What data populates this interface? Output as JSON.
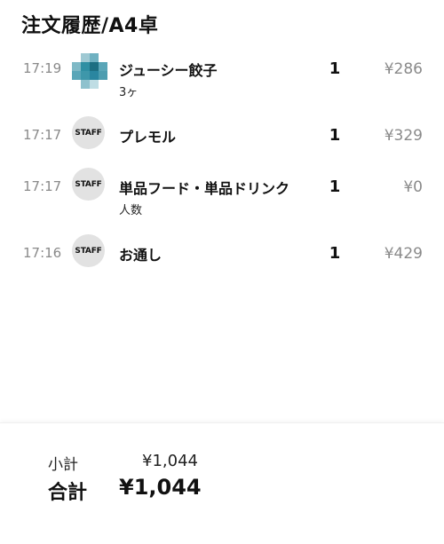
{
  "header": {
    "title": "注文履歴/A4卓"
  },
  "orders": [
    {
      "time": "17:19",
      "avatar_type": "image",
      "icon": "food-photo-thumbnail",
      "name": "ジューシー餃子",
      "sub": "3ヶ",
      "qty": "1",
      "price": "¥286"
    },
    {
      "time": "17:17",
      "avatar_type": "staff",
      "avatar_label": "STAFF",
      "name": "プレモル",
      "sub": "",
      "qty": "1",
      "price": "¥329"
    },
    {
      "time": "17:17",
      "avatar_type": "staff",
      "avatar_label": "STAFF",
      "name": "単品フード・単品ドリンク",
      "sub": "人数",
      "qty": "1",
      "price": "¥0"
    },
    {
      "time": "17:16",
      "avatar_type": "staff",
      "avatar_label": "STAFF",
      "name": "お通し",
      "sub": "",
      "qty": "1",
      "price": "¥429"
    }
  ],
  "summary": {
    "subtotal_label": "小計",
    "subtotal_value": "¥1,044",
    "total_label": "合計",
    "total_value": "¥1,044"
  },
  "colors": {
    "text": "#111111",
    "muted": "#8a8a8a",
    "avatar_bg": "#e2e2e2",
    "thumb_teal": "#2f8fa3"
  }
}
